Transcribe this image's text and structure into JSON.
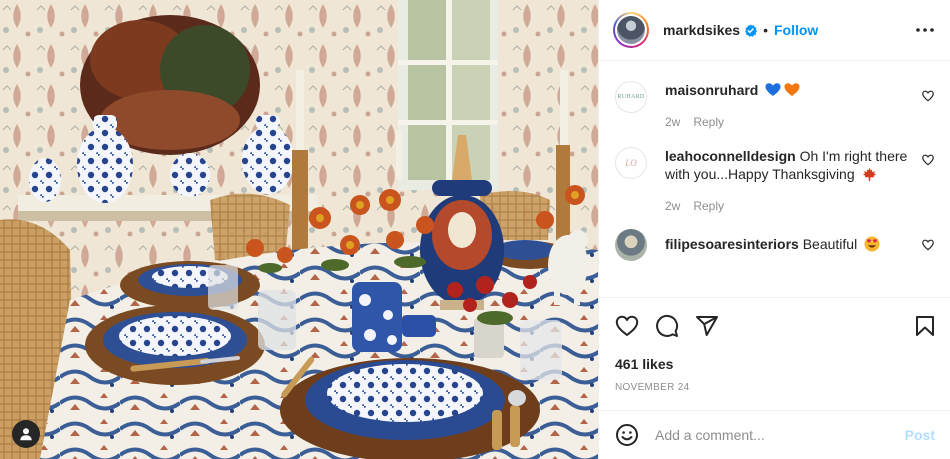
{
  "post": {
    "username": "markdsikes",
    "verified": true,
    "separator": "•",
    "follow_label": "Follow",
    "likes": "461 likes",
    "date": "NOVEMBER 24"
  },
  "comments": [
    {
      "username": "maisonruhard",
      "avatar_text": "RUHARD",
      "text": "",
      "emojis": [
        "blue-heart",
        "orange-heart"
      ],
      "age": "2w",
      "reply_label": "Reply"
    },
    {
      "username": "leahoconnelldesign",
      "avatar_text": "LO",
      "text": "Oh I'm right there with you...Happy Thanksgiving",
      "emojis": [
        "maple-leaf"
      ],
      "age": "2w",
      "reply_label": "Reply"
    },
    {
      "username": "filipesoaresinteriors",
      "text": "Beautiful",
      "emojis": [
        "heart-eyes-face"
      ]
    }
  ],
  "add_comment": {
    "placeholder": "Add a comment...",
    "post_label": "Post"
  },
  "icons": {
    "verified": "verified-badge-icon",
    "more": "more-options-icon",
    "like": "heart-icon",
    "comment": "comment-icon",
    "share": "share-icon",
    "save": "bookmark-icon",
    "emoji": "emoji-icon",
    "user_tag": "user-tag-icon"
  },
  "colors": {
    "accent": "#0095f6",
    "post_disabled": "#b2dffc",
    "text": "#262626",
    "muted": "#8e8e8e",
    "divider": "#efefef"
  }
}
